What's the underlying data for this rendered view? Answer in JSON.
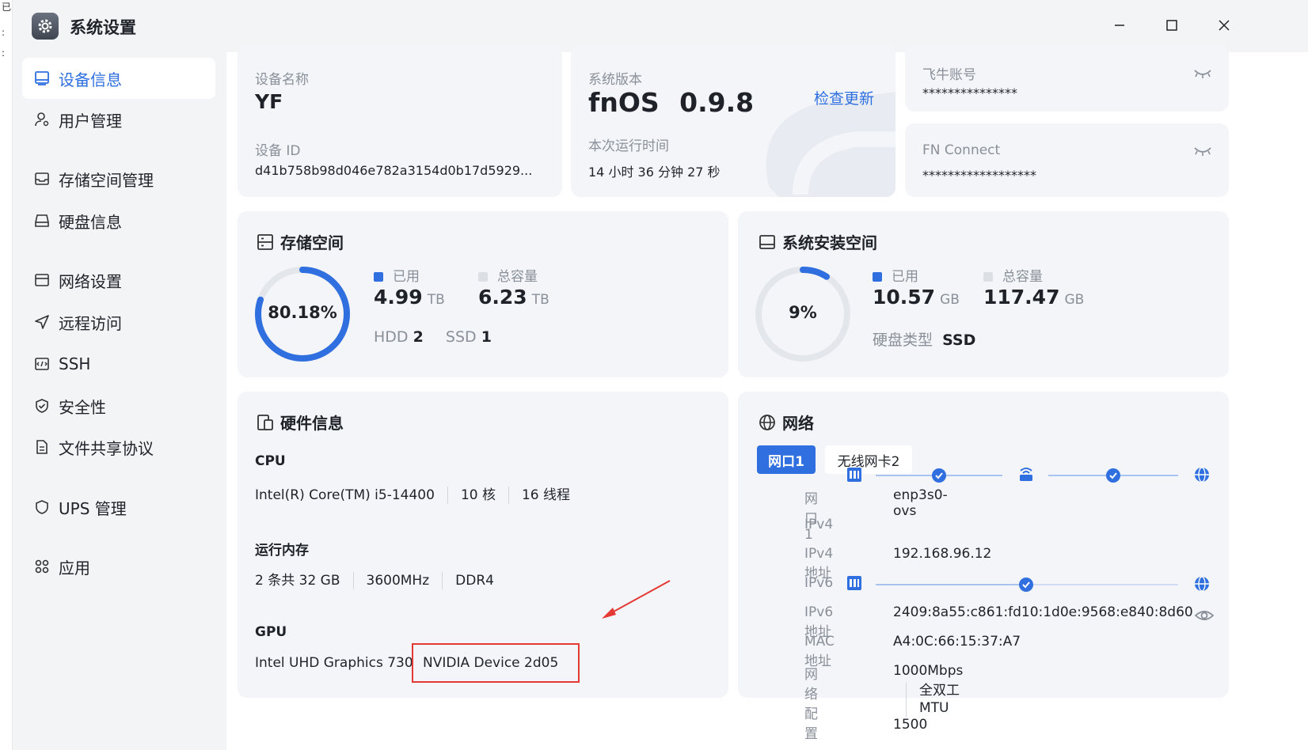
{
  "window": {
    "title": "系统设置"
  },
  "edge_strip": {
    "glyph_top": "已",
    "glyph_mid1": ":",
    "glyph_mid2": ":"
  },
  "sidebar": {
    "items": [
      {
        "label": "设备信息",
        "icon": "monitor-icon",
        "active": true
      },
      {
        "label": "用户管理",
        "icon": "user-icon"
      },
      {
        "label": "存储空间管理",
        "icon": "storage-icon"
      },
      {
        "label": "硬盘信息",
        "icon": "disk-icon"
      },
      {
        "label": "网络设置",
        "icon": "network-icon"
      },
      {
        "label": "远程访问",
        "icon": "send-icon"
      },
      {
        "label": "SSH",
        "icon": "terminal-icon"
      },
      {
        "label": "安全性",
        "icon": "shield-check-icon"
      },
      {
        "label": "文件共享协议",
        "icon": "document-icon"
      },
      {
        "label": "UPS 管理",
        "icon": "shield-icon"
      },
      {
        "label": "应用",
        "icon": "apps-icon"
      }
    ]
  },
  "device": {
    "name_label": "设备名称",
    "name": "YF",
    "id_label": "设备 ID",
    "id": "d41b758b98d046e782a3154d0b17d5929..."
  },
  "system": {
    "version_label": "系统版本",
    "os": "fnOS",
    "version": "0.9.8",
    "check_update": "检查更新",
    "uptime_label": "本次运行时间",
    "uptime": "14 小时 36 分钟 27 秒"
  },
  "accounts": {
    "feiniu_label": "飞牛账号",
    "feiniu_value": "***************",
    "fnconnect_label": "FN Connect",
    "fnconnect_value": "******************"
  },
  "storage": {
    "title": "存储空间",
    "percent": 80.18,
    "percent_text": "80.18%",
    "used_label": "已用",
    "used": "4.99",
    "used_unit": "TB",
    "total_label": "总容量",
    "total": "6.23",
    "total_unit": "TB",
    "hdd_label": "HDD",
    "hdd_count": "2",
    "ssd_label": "SSD",
    "ssd_count": "1"
  },
  "install_space": {
    "title": "系统安装空间",
    "percent": 9,
    "percent_text": "9%",
    "used_label": "已用",
    "used": "10.57",
    "used_unit": "GB",
    "total_label": "总容量",
    "total": "117.47",
    "total_unit": "GB",
    "disk_type_label": "硬盘类型",
    "disk_type": "SSD"
  },
  "hardware": {
    "title": "硬件信息",
    "cpu_label": "CPU",
    "cpu_model": "Intel(R) Core(TM) i5-14400",
    "cpu_cores": "10 核",
    "cpu_threads": "16 线程",
    "mem_label": "运行内存",
    "mem_size": "2 条共 32 GB",
    "mem_speed": "3600MHz",
    "mem_type": "DDR4",
    "gpu_label": "GPU",
    "gpu1": "Intel UHD Graphics 730",
    "gpu2": "NVIDIA Device 2d05"
  },
  "network": {
    "title": "网络",
    "tabs": [
      "网口1",
      "无线网卡2"
    ],
    "rows": {
      "port_label": "网口1",
      "port_value": "enp3s0-ovs",
      "ipv4_label": "IPv4",
      "ipv4_addr_label": "IPv4地址",
      "ipv4_addr": "192.168.96.12",
      "ipv6_label": "IPv6",
      "ipv6_addr_label": "IPv6地址",
      "ipv6_addr": "2409:8a55:c861:fd10:1d0e:9568:e840:8d60",
      "mac_label": "MAC地址",
      "mac": "A4:0C:66:15:37:A7",
      "config_label": "网络配置",
      "speed": "1000Mbps",
      "duplex": "全双工",
      "mtu": "MTU 1500"
    }
  },
  "colors": {
    "accent": "#2f6fe0",
    "annotation": "#e53935",
    "ring_track": "#e3e6ea"
  }
}
